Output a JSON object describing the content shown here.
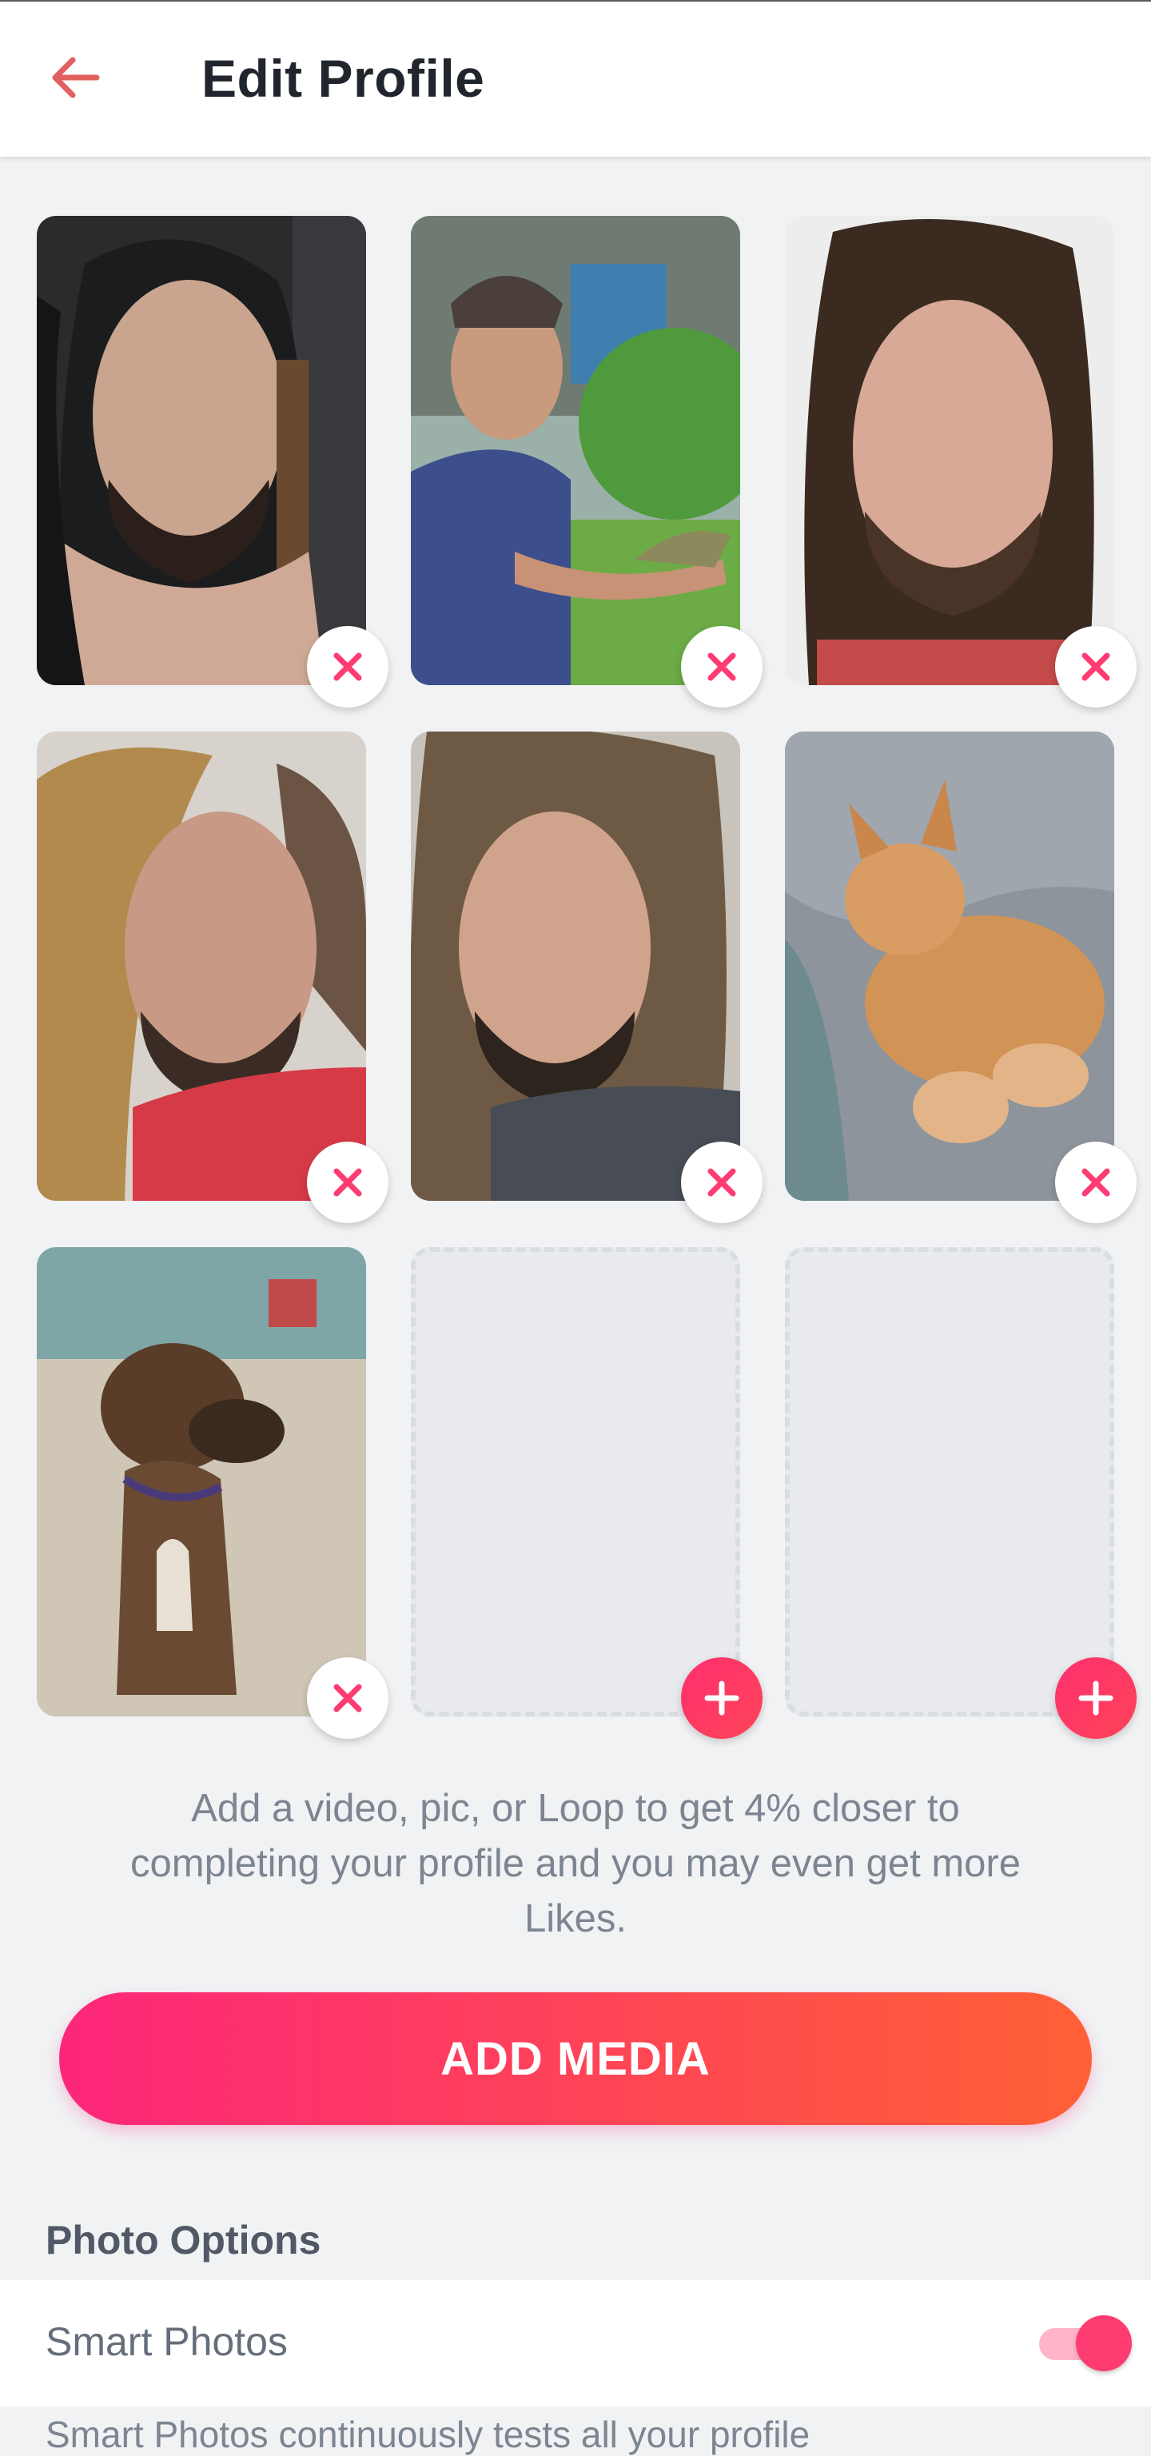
{
  "header": {
    "title": "Edit Profile",
    "back_icon": "arrow-left-icon"
  },
  "photos": [
    {
      "kind": "photo",
      "description_key": "man-guitar",
      "action": "remove"
    },
    {
      "kind": "photo",
      "description_key": "man-fishing",
      "action": "remove"
    },
    {
      "kind": "photo",
      "description_key": "man-portrait",
      "action": "remove"
    },
    {
      "kind": "photo",
      "description_key": "man-side",
      "action": "remove"
    },
    {
      "kind": "photo",
      "description_key": "man-selfie",
      "action": "remove"
    },
    {
      "kind": "photo",
      "description_key": "cat",
      "action": "remove"
    },
    {
      "kind": "photo",
      "description_key": "dog",
      "action": "remove"
    },
    {
      "kind": "empty",
      "action": "add"
    },
    {
      "kind": "empty",
      "action": "add"
    }
  ],
  "hint": "Add a video, pic, or Loop to get 4% closer to completing your profile and you may even get more Likes.",
  "add_media_label": "ADD MEDIA",
  "photo_options": {
    "section_title": "Photo Options",
    "smart_photos_label": "Smart Photos",
    "smart_photos_enabled": true,
    "description_partial": "Smart Photos continuously tests all your profile"
  },
  "colors": {
    "accent": "#fe3c72",
    "gradient_start": "#fd267a",
    "gradient_end": "#ff6036",
    "back_arrow": "#e0615f"
  }
}
